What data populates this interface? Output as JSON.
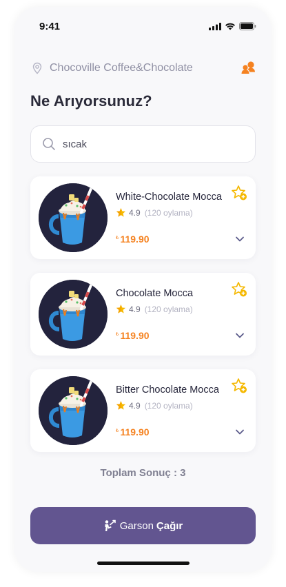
{
  "status_bar": {
    "time": "9:41",
    "icons": [
      "signal-icon",
      "wifi-icon",
      "battery-icon"
    ]
  },
  "header": {
    "location_icon": "location-pin-icon",
    "location_name": "Chocoville Coffee&Chocolate",
    "user_icon": "users-icon"
  },
  "page_title": "Ne Arıyorsunuz?",
  "search": {
    "value": "sıcak",
    "icon": "search-icon"
  },
  "products": [
    {
      "name": "White-Chocolate Mocca",
      "rating": "4.9",
      "rating_count": "(120 oylama)",
      "currency": "₺",
      "price": "119.90"
    },
    {
      "name": "Chocolate Mocca",
      "rating": "4.9",
      "rating_count": "(120 oylama)",
      "currency": "₺",
      "price": "119.90"
    },
    {
      "name": "Bitter Chocolate Mocca",
      "rating": "4.9",
      "rating_count": "(120 oylama)",
      "currency": "₺",
      "price": "119.90"
    }
  ],
  "total_results": "Toplam Sonuç : 3",
  "call_waiter": {
    "label_regular": "Garson",
    "label_bold": "Çağır",
    "icon": "waiter-icon"
  },
  "colors": {
    "accent_orange": "#f58220",
    "button_purple": "#625590",
    "star_yellow": "#f5b800"
  }
}
